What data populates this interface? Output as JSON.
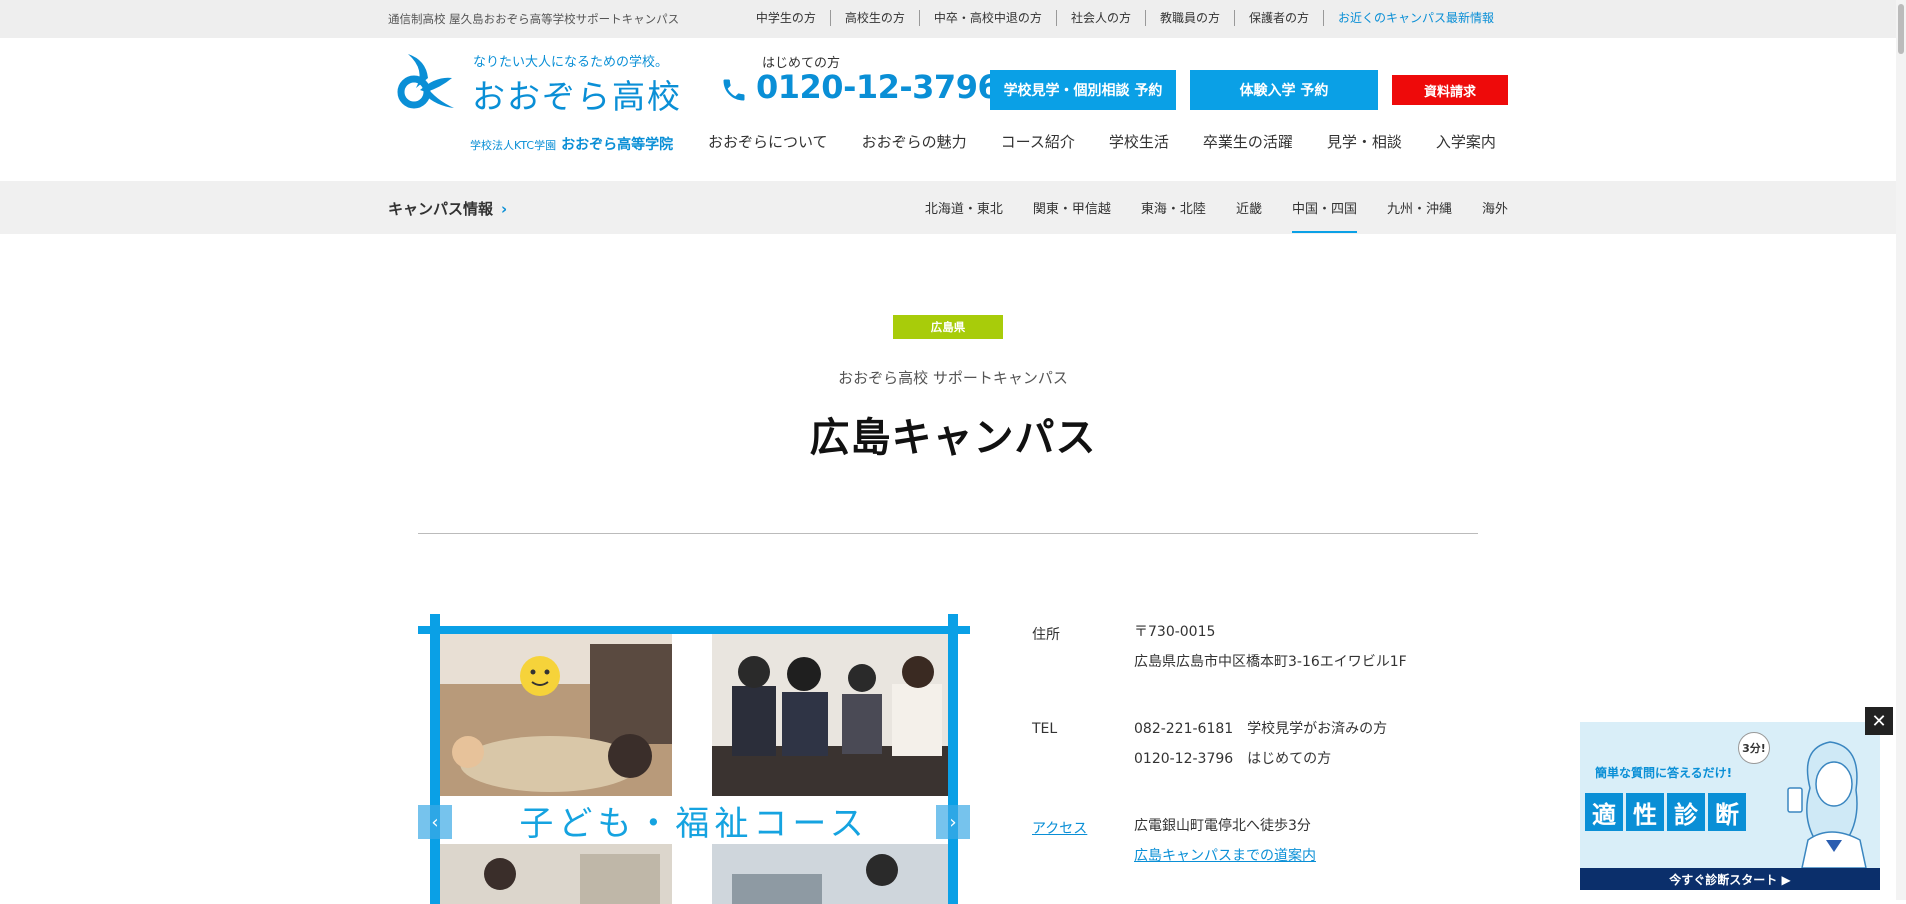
{
  "topbar": {
    "tagline": "通信制高校 屋久島おおぞら高等学校サポートキャンパス",
    "links": [
      "中学生の方",
      "高校生の方",
      "中卒・高校中退の方",
      "社会人の方",
      "教職員の方",
      "保護者の方",
      "お近くのキャンパス最新情報"
    ]
  },
  "logo": {
    "tagline": "なりたい大人になるための学校。",
    "name": "おおぞら高校",
    "sub_small": "学校法人KTC学園",
    "sub_large": "おおぞら高等学院"
  },
  "phone": {
    "label": "はじめての方",
    "number": "0120-12-3796"
  },
  "buttons": {
    "visit": "学校見学・個別相談 予約",
    "trial": "体験入学 予約",
    "docs": "資料請求"
  },
  "mainnav": [
    "おおぞらについて",
    "おおぞらの魅力",
    "コース紹介",
    "学校生活",
    "卒業生の活躍",
    "見学・相談",
    "入学案内"
  ],
  "campus_band": {
    "title": "キャンパス情報",
    "regions": [
      "北海道・東北",
      "関東・甲信越",
      "東海・北陸",
      "近畿",
      "中国・四国",
      "九州・沖縄",
      "海外"
    ],
    "active_region": "中国・四国"
  },
  "hero": {
    "prefecture": "広島県",
    "support": "おおぞら高校 サポートキャンパス",
    "name": "広島キャンパス"
  },
  "slider": {
    "course": "子ども・福祉コース"
  },
  "info": {
    "address_label": "住所",
    "postal": "〒730-0015",
    "address": "広島県広島市中区橋本町3-16エイワビル1F",
    "tel_label": "TEL",
    "tel1": "082-221-6181　学校見学がお済みの方",
    "tel2": "0120-12-3796　はじめての方",
    "access_label": "アクセス",
    "access": "広電銀山町電停北へ徒歩3分",
    "directions": "広島キャンパスまでの道案内"
  },
  "popup": {
    "sub": "簡単な質問に答えるだけ!",
    "minutes": "3分!",
    "chars": [
      "適",
      "性",
      "診",
      "断"
    ],
    "cta": "今すぐ診断スタート ▶"
  },
  "colors": {
    "accent": "#0aa0e6",
    "red": "#ee0a0a",
    "pref": "#a8cc0a"
  }
}
